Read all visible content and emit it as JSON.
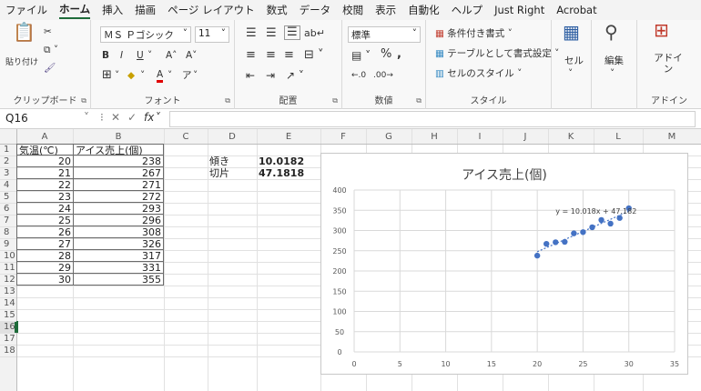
{
  "menu": [
    "ファイル",
    "ホーム",
    "挿入",
    "描画",
    "ページ レイアウト",
    "数式",
    "データ",
    "校閲",
    "表示",
    "自動化",
    "ヘルプ",
    "Just Right",
    "Acrobat"
  ],
  "ribbon": {
    "clipboard": {
      "label": "クリップボード",
      "paste": "貼り付け"
    },
    "font": {
      "label": "フォント",
      "name": "ＭＳ Ｐゴシック",
      "size": "11",
      "bold": "B",
      "italic": "I",
      "underline": "U",
      "grow": "A˄",
      "shrink": "A˅",
      "color_a": "A",
      "phonetic": "ア"
    },
    "alignment": {
      "label": "配置"
    },
    "number": {
      "label": "数値",
      "format": "標準",
      "percent": "%",
      "comma": ","
    },
    "styles": {
      "label": "スタイル",
      "cond": "条件付き書式",
      "table": "テーブルとして書式設定",
      "cell": "セルのスタイル"
    },
    "cells": {
      "label": "セル"
    },
    "editing": {
      "label": "編集"
    },
    "addins": {
      "label": "アドイン",
      "btn": "アドイン"
    }
  },
  "formula_bar": {
    "namebox": "Q16",
    "fx": "fx",
    "value": ""
  },
  "columns": [
    "A",
    "B",
    "C",
    "D",
    "E",
    "F",
    "G",
    "H",
    "I",
    "J",
    "K",
    "L",
    "M"
  ],
  "rows": [
    "1",
    "2",
    "3",
    "4",
    "5",
    "6",
    "7",
    "8",
    "9",
    "10",
    "11",
    "12",
    "13",
    "14",
    "15",
    "16",
    "17",
    "18"
  ],
  "table": {
    "header": [
      "気温(℃)",
      "アイス売上(個)"
    ],
    "rows": [
      [
        "20",
        "238"
      ],
      [
        "21",
        "267"
      ],
      [
        "22",
        "271"
      ],
      [
        "23",
        "272"
      ],
      [
        "24",
        "293"
      ],
      [
        "25",
        "296"
      ],
      [
        "26",
        "308"
      ],
      [
        "27",
        "326"
      ],
      [
        "28",
        "317"
      ],
      [
        "29",
        "331"
      ],
      [
        "30",
        "355"
      ]
    ]
  },
  "stats": {
    "slope_label": "傾き",
    "slope_value": "10.0182",
    "intercept_label": "切片",
    "intercept_value": "47.1818"
  },
  "chart_data": {
    "type": "scatter",
    "title": "アイス売上(個)",
    "x": [
      20,
      21,
      22,
      23,
      24,
      25,
      26,
      27,
      28,
      29,
      30
    ],
    "y": [
      238,
      267,
      271,
      272,
      293,
      296,
      308,
      326,
      317,
      331,
      355
    ],
    "xlim": [
      0,
      35
    ],
    "ylim": [
      0,
      400
    ],
    "xticks": [
      "0",
      "5",
      "10",
      "15",
      "20",
      "25",
      "30",
      "35"
    ],
    "yticks": [
      "0",
      "50",
      "100",
      "150",
      "200",
      "250",
      "300",
      "350",
      "400"
    ],
    "trendline": {
      "slope": 10.018,
      "intercept": 47.182,
      "label": "y = 10.018x + 47.182"
    },
    "grid": true,
    "point_color": "#4472C4"
  }
}
